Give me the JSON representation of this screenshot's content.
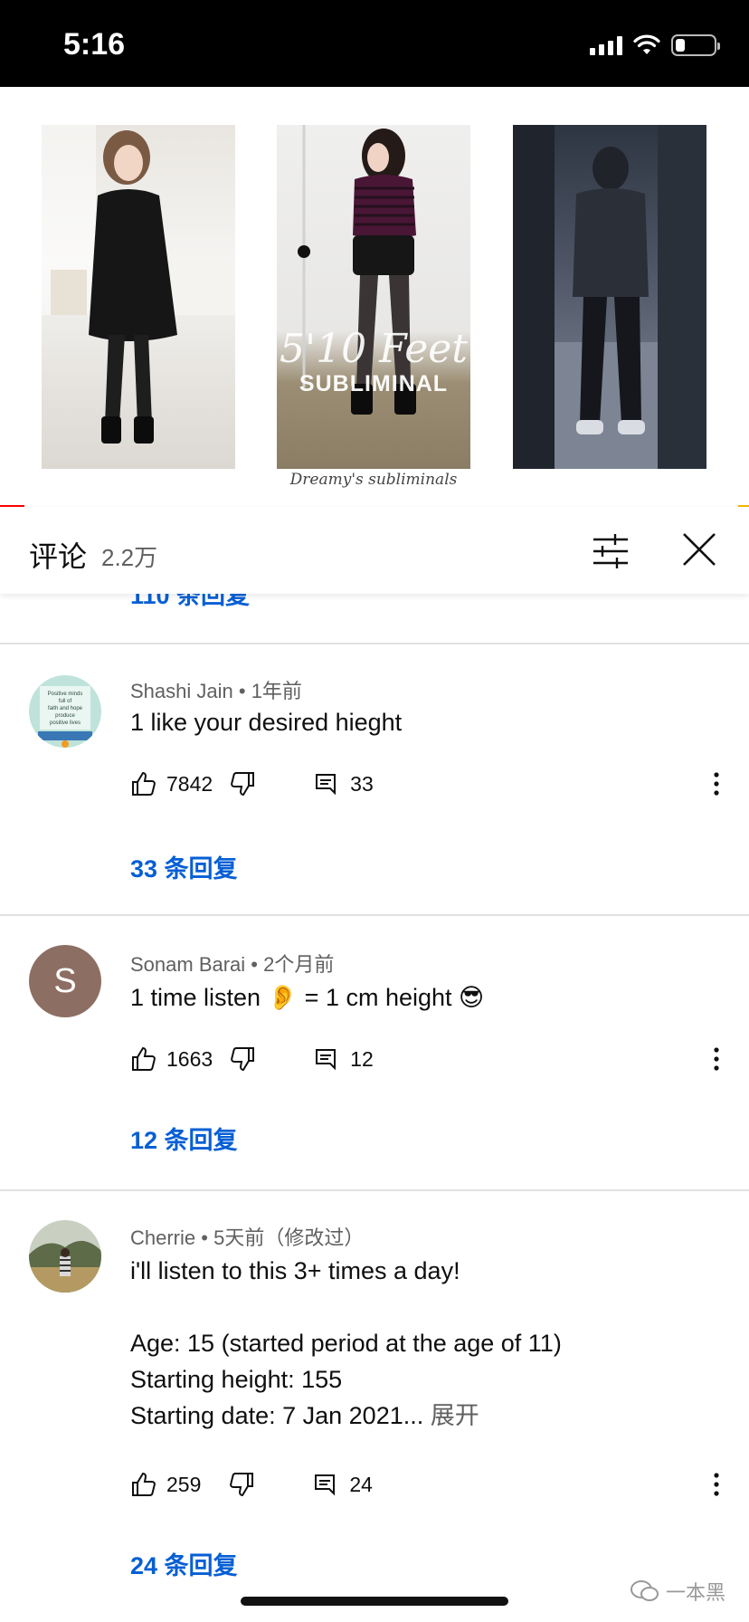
{
  "status_bar": {
    "time": "5:16",
    "battery_level": 0.25
  },
  "video": {
    "thumb_text_1": "5'10 Feet",
    "thumb_text_2": "SUBLIMINAL",
    "caption": "Dreamy's subliminals"
  },
  "panel": {
    "title": "评论",
    "count": "2.2万"
  },
  "peek_replies": "110 条回复",
  "comments": [
    {
      "author": "Shashi Jain",
      "time": "1年前",
      "text": "1 like your desired hieght",
      "likes": "7842",
      "replies_count": "33",
      "replies_link": "33 条回复",
      "avatar_text": "Positive minds full of faith and hope produce positive lives. Good Morning"
    },
    {
      "author": "Sonam Barai",
      "time": "2个月前",
      "text": "1 time listen 👂 = 1 cm height 😎",
      "likes": "1663",
      "replies_count": "12",
      "replies_link": "12 条回复",
      "avatar_letter": "S",
      "avatar_color": "#8d6e63"
    },
    {
      "author": "Cherrie",
      "time": "5天前（修改过）",
      "text": "i'll listen to this 3+ times a day!\n\nAge: 15 (started period at the age of 11)\nStarting height: 155\nStarting date: 7 Jan 2021...",
      "expand": " 展开",
      "likes": "259",
      "replies_count": "24",
      "replies_link": "24 条回复"
    }
  ],
  "watermark": "一本黑"
}
